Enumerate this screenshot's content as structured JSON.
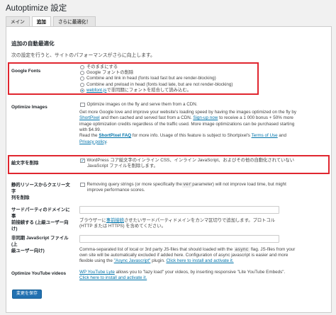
{
  "page": {
    "title": "Autoptimize 設定"
  },
  "tabs": [
    {
      "label": "メイン",
      "active": false
    },
    {
      "label": "追加",
      "active": true
    },
    {
      "label": "さらに最適化！",
      "active": false
    }
  ],
  "section": {
    "title": "追加の自動最適化",
    "description": "次の設定を行うと、サイトのパフォーマンスがさらに向上します。"
  },
  "google_fonts": {
    "label": "Google Fonts",
    "options": [
      {
        "text": "そのままにする",
        "selected": false
      },
      {
        "text": "Google フォントの削除",
        "selected": false
      },
      {
        "text": "Combine and link in head (fonts load fast but are render-blocking)",
        "selected": false
      },
      {
        "text": "Combine and preload in head (fonts load late, but are not render-blocking)",
        "selected": false
      },
      {
        "link": "webfont.js",
        "text": " で非同期にフォントを結合して読み込む。",
        "selected": true
      }
    ]
  },
  "optimize_images": {
    "label": "Optimize Images",
    "checkbox_text": "Optimize images on the fly and serve them from a CDN.",
    "desc1": "Get more Google love and improve your website's loading speed by having the images optimized on the fly by",
    "link_shortpixel": "ShortPixel",
    "desc2": " and then cached and served fast from a CDN. ",
    "link_signup": "Sign-up now",
    "desc3": " to receive a 1 000 bonus + 50% more",
    "desc4": "image optimization credits regardless of the traffic used. More image optimizations can be purchased starting",
    "desc5": "with $4.99.",
    "desc6a": "Read the ",
    "link_faq": "ShortPixel FAQ",
    "desc6b": " for more info. Usage of this feature is subject to Shortpixel's ",
    "link_terms": "Terms of Use",
    "desc6c": " and",
    "link_privacy": "Privacy policy",
    "desc7": "."
  },
  "emoji": {
    "label": "絵文字を削除",
    "checked": true,
    "line1": "WordPress コア絵文字のインライン CSS、インライン JavaScript、およびその他の自動化されていない",
    "line2": "JavaScript ファイルを削除します。"
  },
  "query_strings": {
    "label_line1": "静的リソースからクエリー文字",
    "label_line2": "列を削除",
    "text1": "Removing query strings (or more specifically the ",
    "code": "ver",
    "text2": " parameter) will not improve load time, but might",
    "text3": "improve performance scores."
  },
  "preconnect": {
    "label_line1": "サードパーティのドメインに事",
    "label_line2": "前接続する (上級ユーザー向け)",
    "value": "",
    "help1a": "ブラウザーに",
    "help_link": "事前接続",
    "help1b": "させたいサードパーティドメインをカンマ区切りで追加します。プロトコル",
    "help2": "(HTTP または HTTPS) を含めてください。"
  },
  "async_js": {
    "label_line1": "非同期 JavaScript ファイル (上",
    "label_line2": "級ユーザー向け)",
    "value": "",
    "help1a": "Comma-separated list of local or 3rd party JS-files that should loaded with the ",
    "help_code": "async",
    "help1b": " flag. JS-files from your",
    "help2": "own site will be automatically excluded if added here. Configuration of async javascript is easier and more",
    "help3a": "flexible using the ",
    "help_link": "\"Async Javascript\"",
    "help3b": " plugin. ",
    "help_link2": "Click here to install and activate it."
  },
  "youtube": {
    "label": "Optimize YouTube videos",
    "link_lyte": "WP YouTube Lyte",
    "text1": " allows you to \"lazy load\" your videos, by inserting responsive \"Lite YouTube Embeds\". ",
    "link_install": "Click here to install and activate it."
  },
  "save_button": {
    "label": "変更を保存"
  },
  "colors": {
    "accent": "#2271b1",
    "link": "#0073aa",
    "highlight": "#e0262f"
  }
}
